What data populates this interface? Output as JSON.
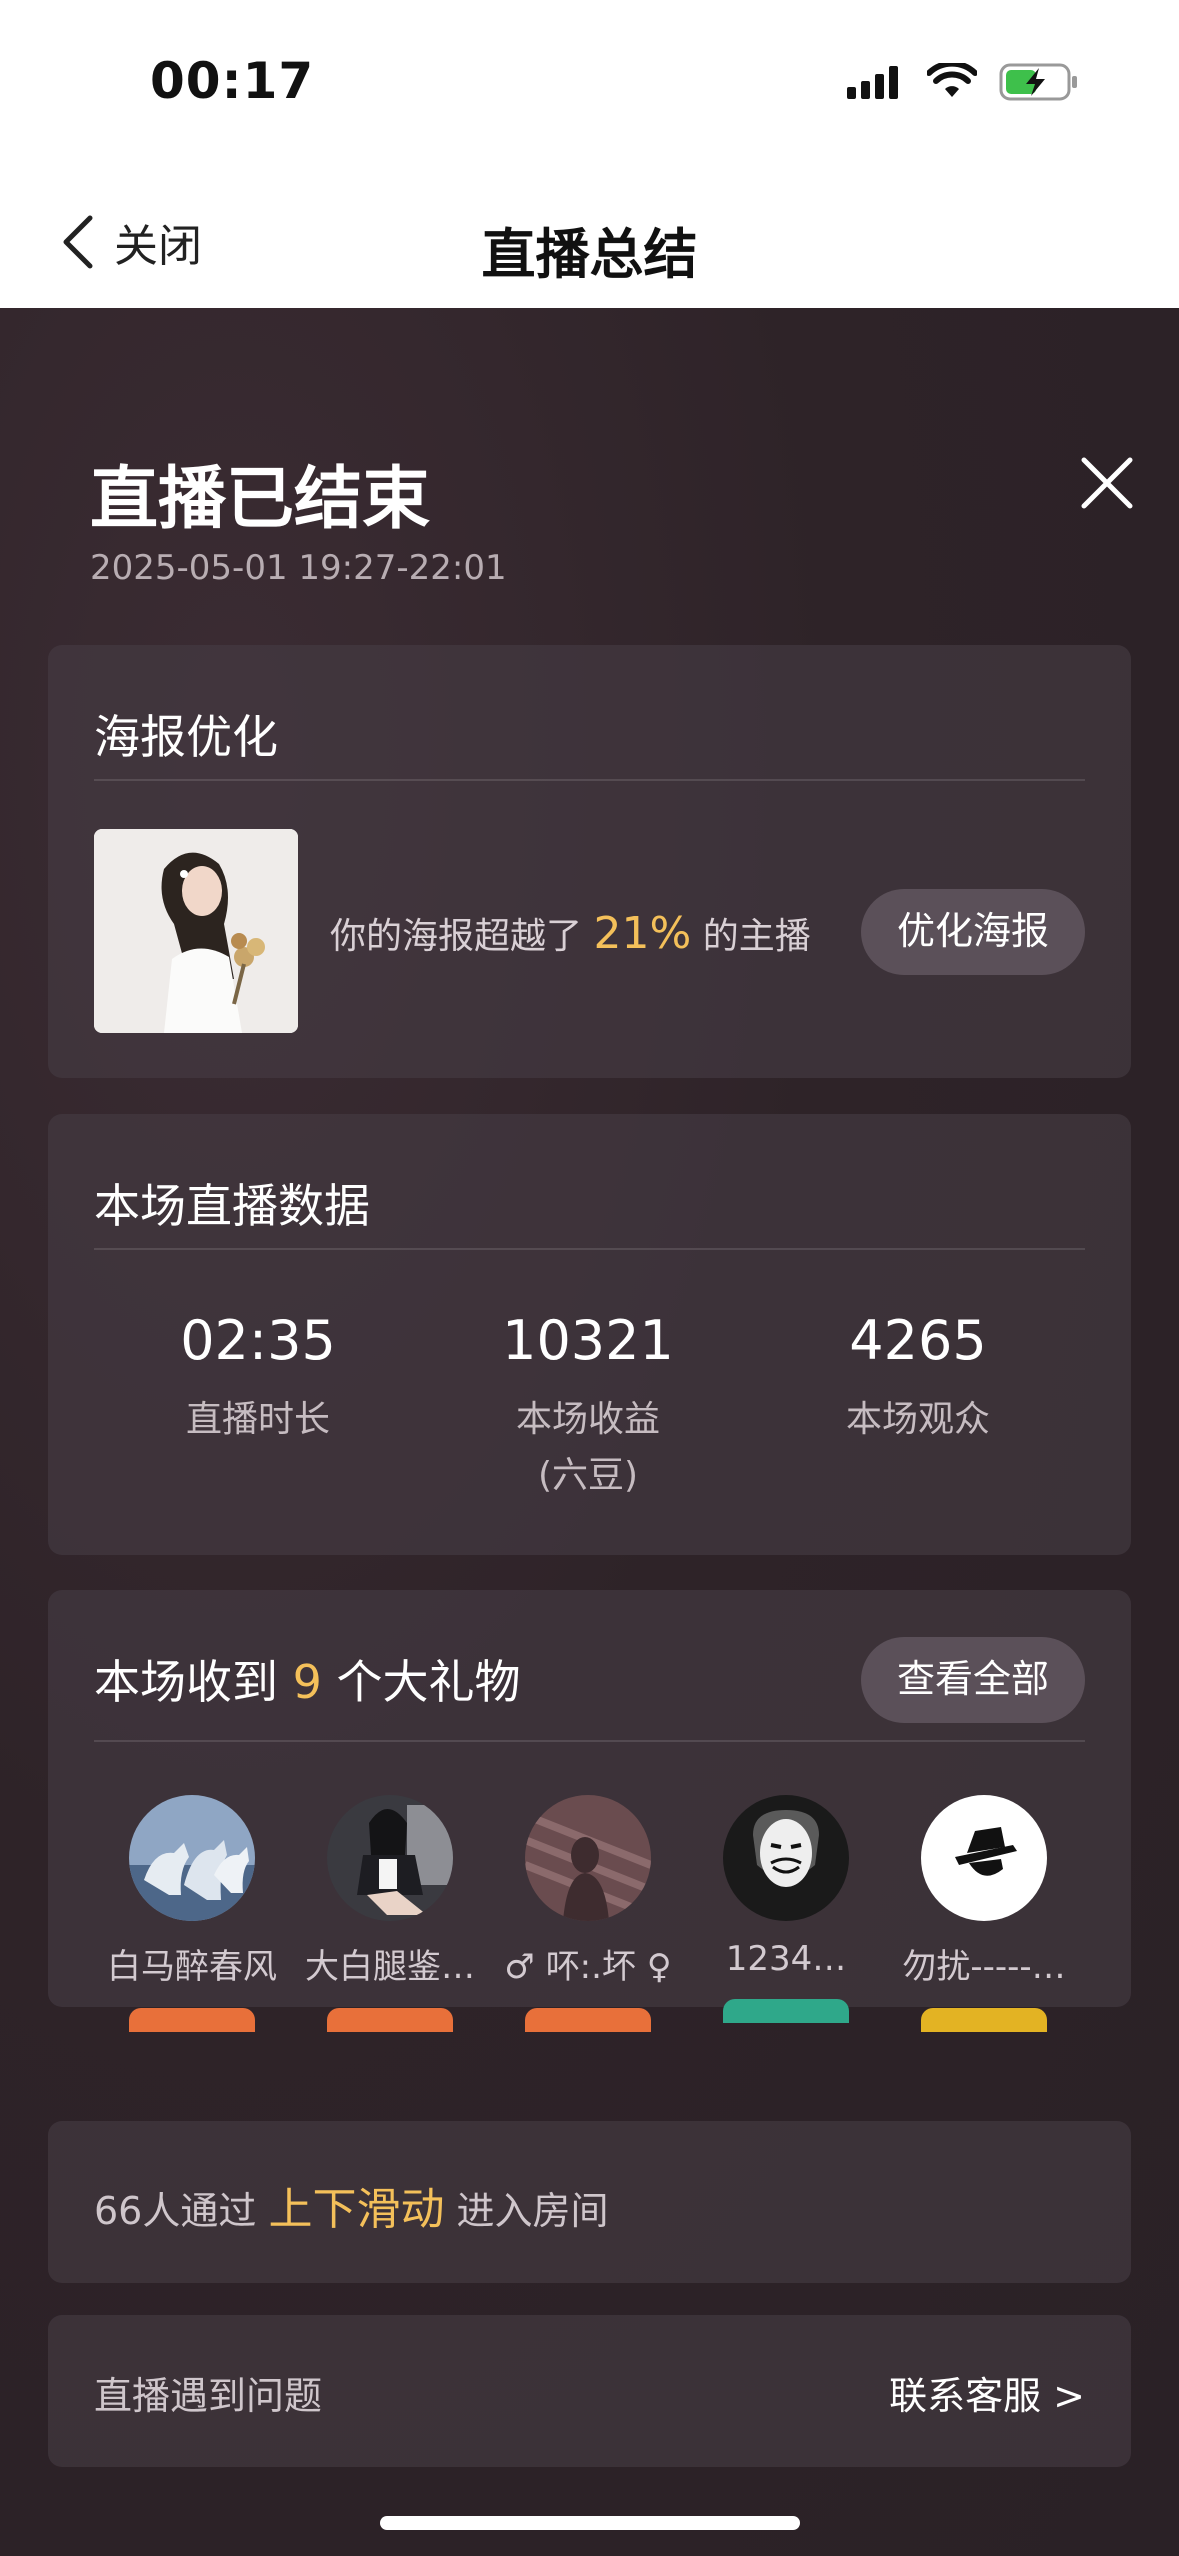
{
  "status_bar": {
    "time": "00:17"
  },
  "nav": {
    "back_label": "关闭",
    "title": "直播总结"
  },
  "summary": {
    "title": "直播已结束",
    "time_range": "2025-05-01 19:27-22:01"
  },
  "poster": {
    "title": "海报优化",
    "text_prefix": "你的海报超越了",
    "percent": "21%",
    "text_suffix": "的主播",
    "button": "优化海报"
  },
  "stats": {
    "title": "本场直播数据",
    "items": [
      {
        "value": "02:35",
        "label": "直播时长"
      },
      {
        "value": "10321",
        "label": "本场收益",
        "sub": "(六豆)"
      },
      {
        "value": "4265",
        "label": "本场观众"
      }
    ]
  },
  "gifts": {
    "title_prefix": "本场收到",
    "count": "9",
    "title_suffix": "个大礼物",
    "view_all": "查看全部",
    "senders": [
      {
        "name": "白马醉春风",
        "avatar": "horses-avatar",
        "badge_color": "#e8703a"
      },
      {
        "name": "大白腿鉴…",
        "avatar": "woman-avatar",
        "badge_color": "#e8703a"
      },
      {
        "name": "♂ 吥:.坏 ♀",
        "avatar": "shadow-avatar",
        "badge_color": "#e8703a"
      },
      {
        "name": "1234…",
        "avatar": "mask-avatar",
        "badge_color": "#2fa88a"
      },
      {
        "name": "勿扰-----…",
        "avatar": "hat-avatar",
        "badge_color": "#e3b323"
      }
    ]
  },
  "swipe": {
    "prefix": "66人通过",
    "highlight": "上下滑动",
    "suffix": "进入房间"
  },
  "support": {
    "left": "直播遇到问题",
    "right": "联系客服 >"
  },
  "colors": {
    "accent": "#f4c05a",
    "background": "#2b2227"
  }
}
